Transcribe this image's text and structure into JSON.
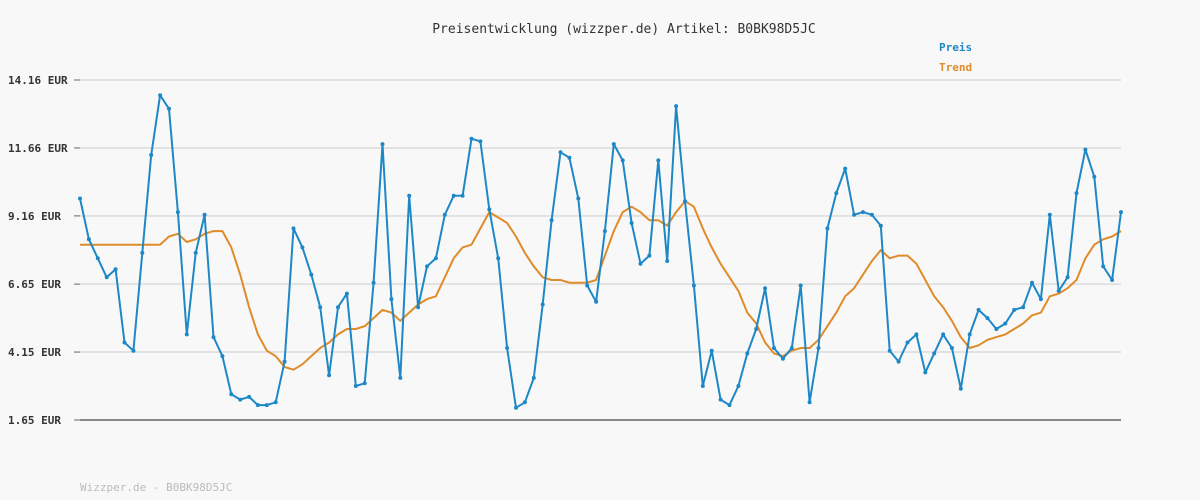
{
  "chart_data": {
    "type": "line",
    "title": "Preisentwicklung (wizzper.de) Artikel: B0BK98D5JC",
    "xlabel": "",
    "ylabel": "",
    "ylim": [
      1.65,
      14.16
    ],
    "yticks": [
      "14.16 EUR",
      "11.66 EUR",
      "9.16 EUR",
      "6.65 EUR",
      "4.15 EUR",
      "1.65 EUR"
    ],
    "ytick_values": [
      14.16,
      11.66,
      9.16,
      6.65,
      4.15,
      1.65
    ],
    "grid": true,
    "legend_position": "top-right",
    "x": [
      0,
      1,
      2,
      3,
      4,
      5,
      6,
      7,
      8,
      9,
      10,
      11,
      12,
      13,
      14,
      15,
      16,
      17,
      18,
      19,
      20,
      21,
      22,
      23,
      24,
      25,
      26,
      27,
      28,
      29,
      30,
      31,
      32,
      33,
      34,
      35,
      36,
      37,
      38,
      39,
      40,
      41,
      42,
      43,
      44,
      45,
      46,
      47,
      48,
      49,
      50,
      51,
      52,
      53,
      54,
      55,
      56,
      57,
      58,
      59,
      60,
      61,
      62,
      63,
      64,
      65,
      66,
      67,
      68,
      69,
      70,
      71,
      72,
      73,
      74,
      75,
      76,
      77,
      78,
      79,
      80,
      81,
      82,
      83,
      84,
      85,
      86,
      87,
      88,
      89,
      90,
      91,
      92,
      93,
      94,
      95,
      96,
      97,
      98,
      99,
      100,
      101,
      102,
      103,
      104,
      105,
      106,
      107,
      108,
      109,
      110,
      111,
      112,
      113,
      114,
      115,
      116,
      117
    ],
    "series": [
      {
        "name": "Preis",
        "color": "#1e88c7",
        "values": [
          9.8,
          8.3,
          7.6,
          6.9,
          7.2,
          4.5,
          4.2,
          7.8,
          11.4,
          13.6,
          13.1,
          9.3,
          4.8,
          7.8,
          9.2,
          4.7,
          4.0,
          2.6,
          2.4,
          2.5,
          2.2,
          2.2,
          2.3,
          3.8,
          8.7,
          8.0,
          7.0,
          5.8,
          3.3,
          5.8,
          6.3,
          2.9,
          3.0,
          6.7,
          11.8,
          6.1,
          3.2,
          9.9,
          5.8,
          7.3,
          7.6,
          9.2,
          9.9,
          9.9,
          12.0,
          11.9,
          9.4,
          7.6,
          4.3,
          2.1,
          2.3,
          3.2,
          5.9,
          9.0,
          11.5,
          11.3,
          9.8,
          6.6,
          6.0,
          8.6,
          11.8,
          11.2,
          8.9,
          7.4,
          7.7,
          11.2,
          7.5,
          13.2,
          9.7,
          6.6,
          2.9,
          4.2,
          2.4,
          2.2,
          2.9,
          4.1,
          5.0,
          6.5,
          4.3,
          3.9,
          4.3,
          6.6,
          2.3,
          4.3,
          8.7,
          10.0,
          10.9,
          9.2,
          9.3,
          9.2,
          8.8,
          4.2,
          3.8,
          4.5,
          4.8,
          3.4,
          4.1,
          4.8,
          4.3,
          2.8,
          4.8,
          5.7,
          5.4,
          5.0,
          5.2,
          5.7,
          5.8,
          6.7,
          6.1,
          9.2,
          6.4,
          6.9,
          10.0,
          11.6,
          10.6,
          7.3,
          6.8,
          9.3
        ]
      },
      {
        "name": "Trend",
        "color": "#e08b2a",
        "values": [
          8.1,
          8.1,
          8.1,
          8.1,
          8.1,
          8.1,
          8.1,
          8.1,
          8.1,
          8.1,
          8.4,
          8.5,
          8.2,
          8.3,
          8.5,
          8.6,
          8.6,
          8.0,
          7.0,
          5.8,
          4.8,
          4.2,
          4.0,
          3.6,
          3.5,
          3.7,
          4.0,
          4.3,
          4.5,
          4.8,
          5.0,
          5.0,
          5.1,
          5.4,
          5.7,
          5.6,
          5.3,
          5.6,
          5.9,
          6.1,
          6.2,
          6.9,
          7.6,
          8.0,
          8.1,
          8.7,
          9.3,
          9.1,
          8.9,
          8.4,
          7.8,
          7.3,
          6.9,
          6.8,
          6.8,
          6.7,
          6.7,
          6.7,
          6.8,
          7.7,
          8.6,
          9.3,
          9.5,
          9.3,
          9.0,
          9.0,
          8.8,
          9.3,
          9.7,
          9.5,
          8.7,
          8.0,
          7.4,
          6.9,
          6.4,
          5.6,
          5.2,
          4.5,
          4.1,
          4.0,
          4.2,
          4.3,
          4.3,
          4.6,
          5.1,
          5.6,
          6.2,
          6.5,
          7.0,
          7.5,
          7.9,
          7.6,
          7.7,
          7.7,
          7.4,
          6.8,
          6.2,
          5.8,
          5.3,
          4.7,
          4.3,
          4.4,
          4.6,
          4.7,
          4.8,
          5.0,
          5.2,
          5.5,
          5.6,
          6.2,
          6.3,
          6.5,
          6.8,
          7.6,
          8.1,
          8.3,
          8.4,
          8.6
        ]
      }
    ]
  },
  "footer": "Wizzper.de - B0BK98D5JC"
}
